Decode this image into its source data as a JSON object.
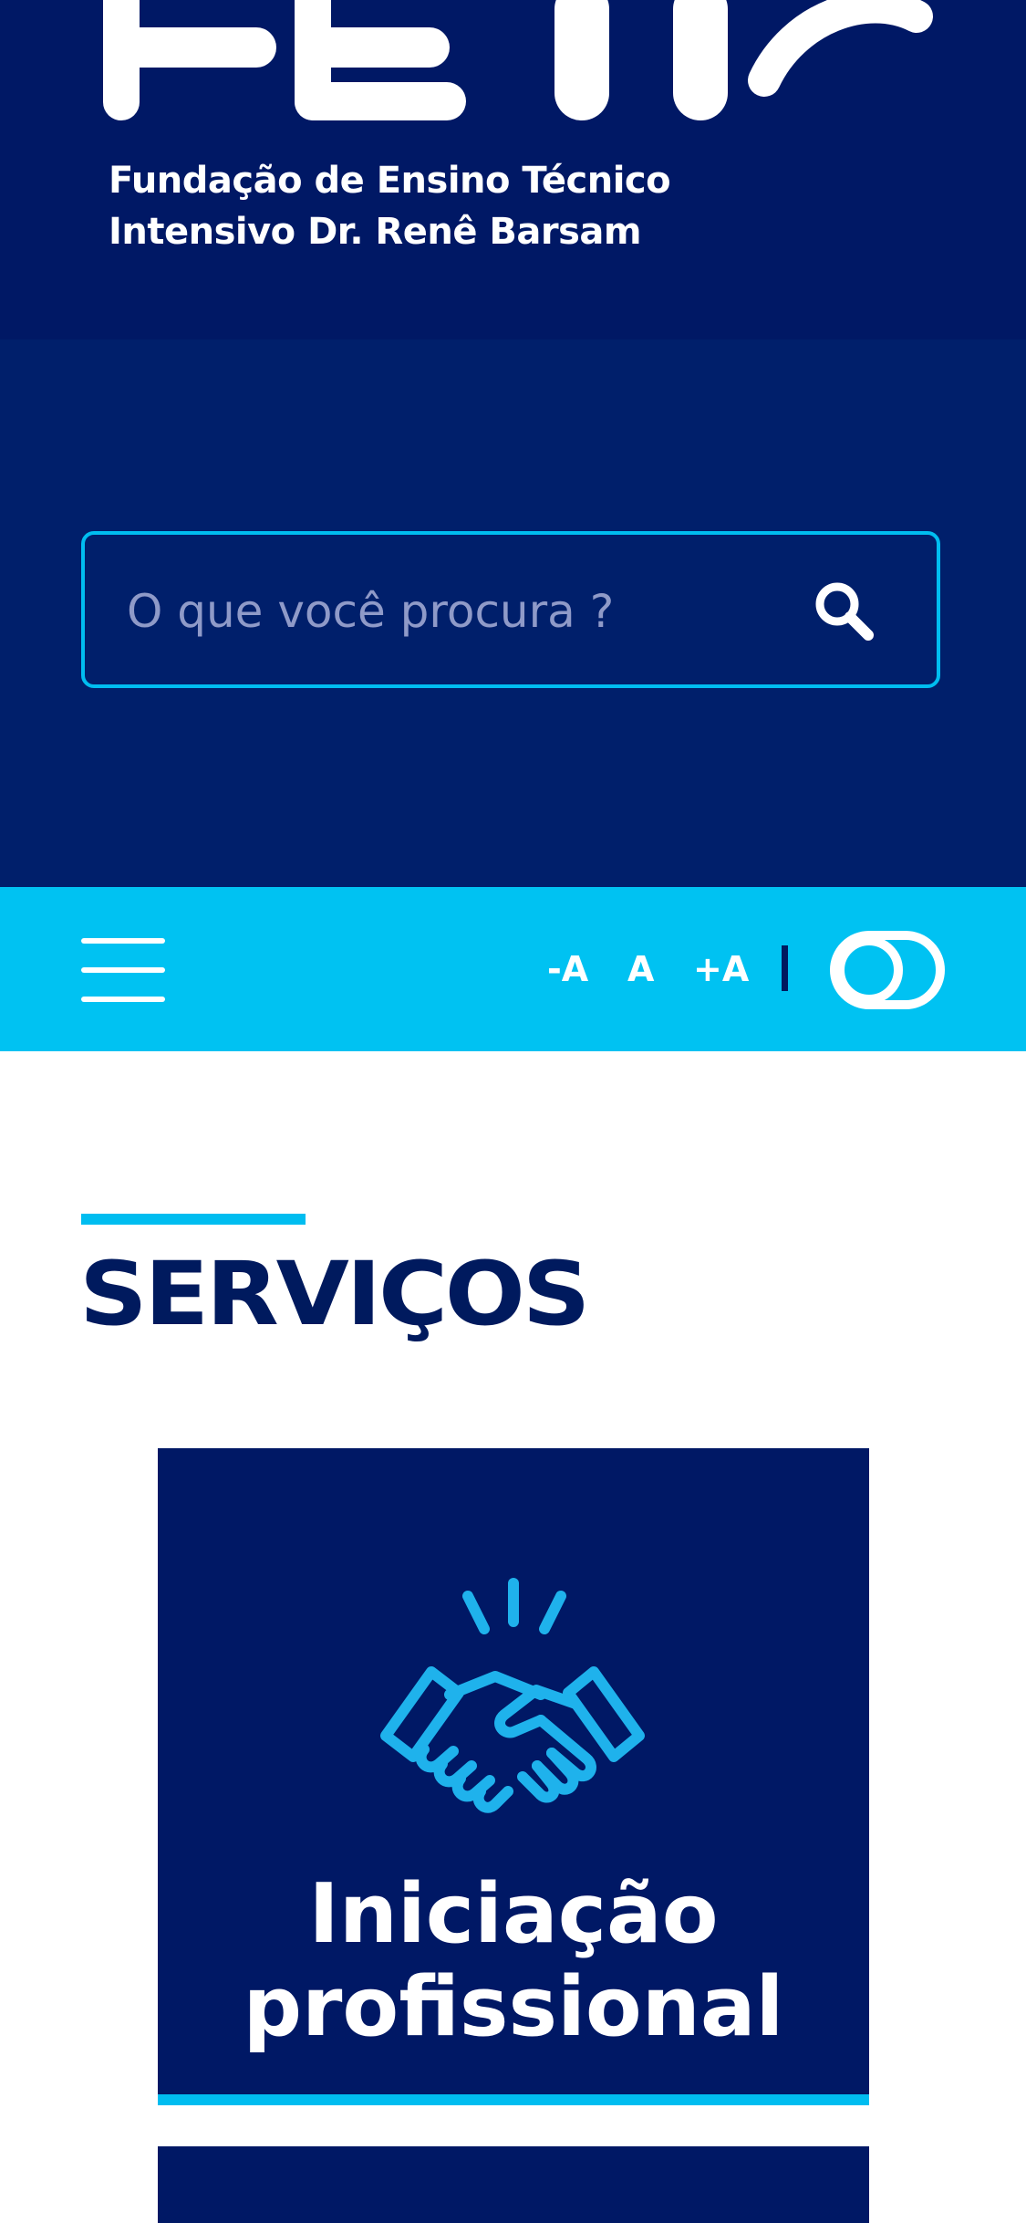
{
  "header": {
    "logo_name": "FETIR",
    "subtitle_line1": "Fundação de Ensino Técnico",
    "subtitle_line2": "Intensivo Dr. Renê Barsam"
  },
  "search": {
    "placeholder": "O que você procura ?",
    "icon": "search-icon"
  },
  "accessibility": {
    "menu_icon": "hamburger-menu-icon",
    "decrease_font": "-A",
    "default_font": "A",
    "increase_font": "+A",
    "contrast_icon": "contrast-toggle-icon"
  },
  "services": {
    "title": "SERVIÇOS",
    "cards": [
      {
        "icon": "handshake-icon",
        "label_line1": "Iniciação",
        "label_line2": "profissional"
      }
    ]
  },
  "colors": {
    "header_bg": "#001865",
    "search_bg": "#001f6b",
    "accent": "#00bdf0",
    "bar_bg": "#00c2f2",
    "title": "#001a5e"
  }
}
